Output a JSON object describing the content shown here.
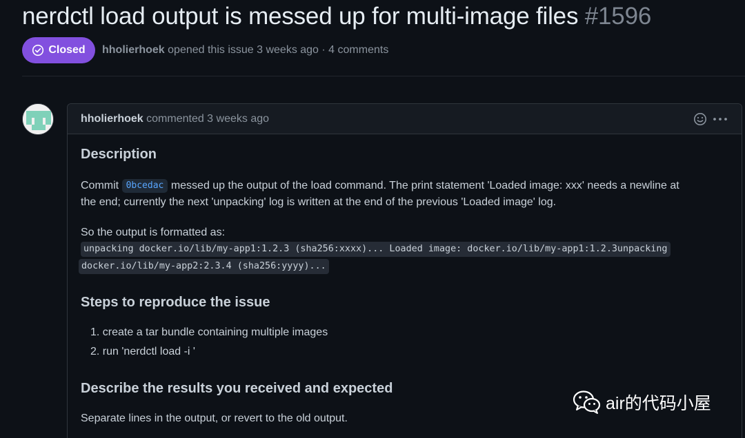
{
  "issue": {
    "title": "nerdctl load output is messed up for multi-image files",
    "number": "#1596",
    "state": "Closed",
    "author": "hholierhoek",
    "meta_text": "opened this issue 3 weeks ago · 4 comments"
  },
  "comment": {
    "author": "hholierhoek",
    "header_text": "commented 3 weeks ago",
    "heading_description": "Description",
    "commit_prefix": "Commit",
    "commit_sha": "0bcedac",
    "commit_line_1": "messed up the output of the load command. The print statement 'Loaded image: xxx' needs a newline at",
    "commit_line_2": "the end; currently the next 'unpacking' log is written at the end of the previous 'Loaded image' log.",
    "formatted_label": "So the output is formatted as:",
    "code_line_1": "unpacking docker.io/lib/my-app1:1.2.3 (sha256:xxxx)... Loaded image: docker.io/lib/my-app1:1.2.3unpacking",
    "code_line_2": "docker.io/lib/my-app2:2.3.4 (sha256:yyyy)...",
    "heading_steps": "Steps to reproduce the issue",
    "steps": [
      "1. create a tar bundle containing multiple images",
      "2. run 'nerdctl load -i '"
    ],
    "heading_results": "Describe the results you received and expected",
    "results_text": "Separate lines in the output, or revert to the old output."
  },
  "watermark": {
    "text": "air的代码小屋",
    "icon": "wechat-icon"
  },
  "colors": {
    "background": "#0d1117",
    "closed_badge": "#8250df",
    "link": "#58a6ff",
    "border": "#30363d"
  }
}
